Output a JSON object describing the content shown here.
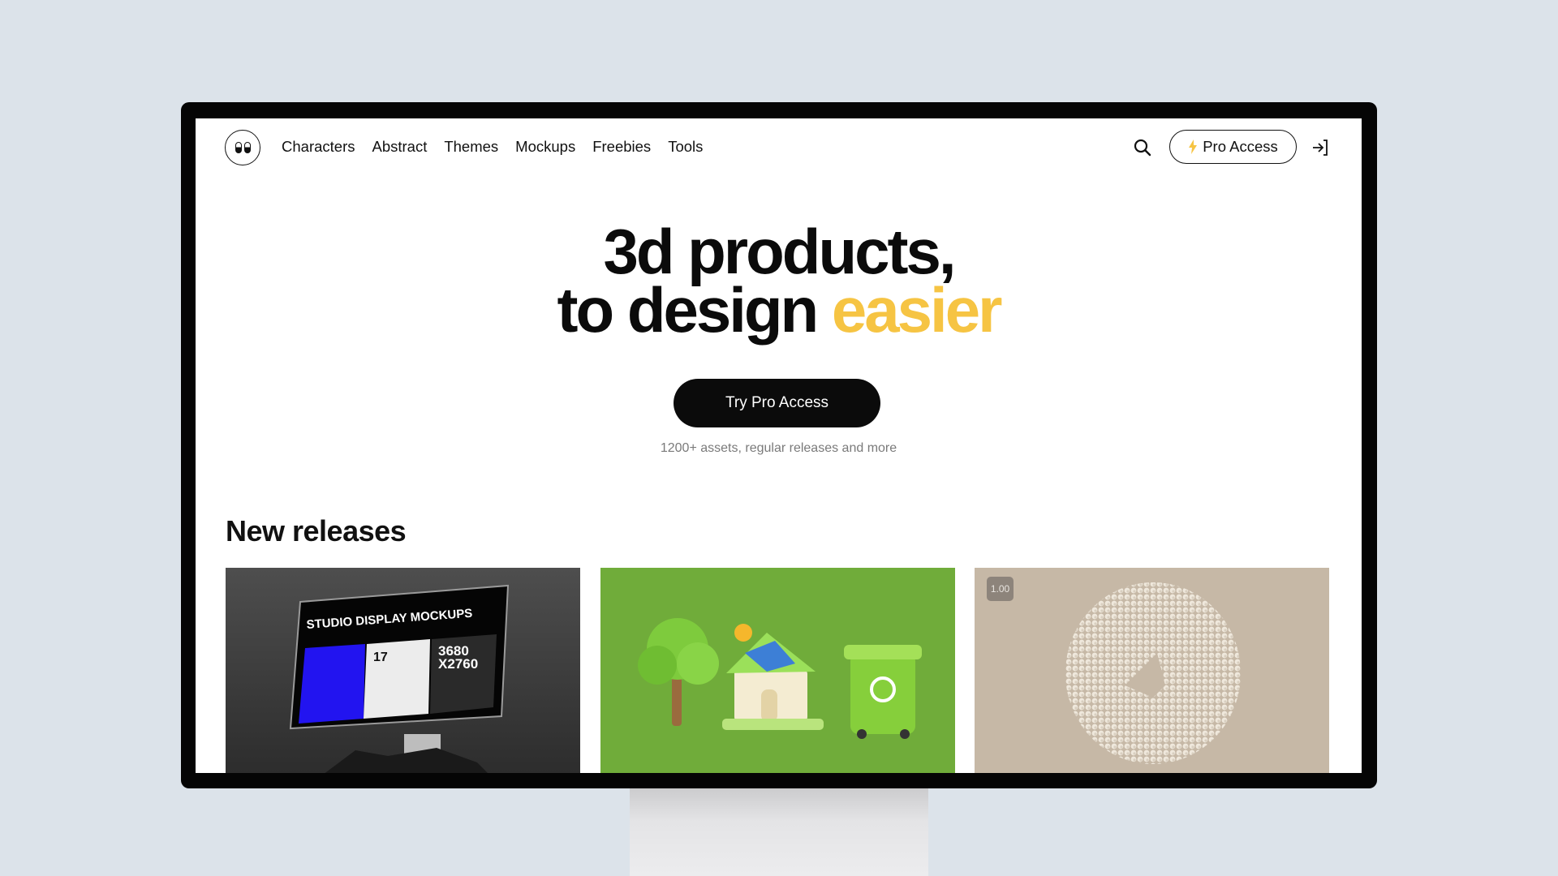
{
  "nav": {
    "logo_icon": "eyes-logo-icon",
    "links": [
      "Characters",
      "Abstract",
      "Themes",
      "Mockups",
      "Freebies",
      "Tools"
    ],
    "search_icon": "search-icon",
    "pro_button": "Pro Access",
    "pro_icon": "lightning-icon",
    "login_icon": "login-arrow-icon"
  },
  "hero": {
    "line1": "3d products,",
    "line2_prefix": "to design ",
    "line2_accent": "easier",
    "cta": "Try Pro Access",
    "subtext": "1200+ assets, regular releases and more"
  },
  "releases": {
    "title": "New releases",
    "cards": [
      {
        "name": "studio-display-mockups",
        "mock_title": "STUDIO DISPLAY MOCKUPS",
        "mock_num": "17",
        "mock_res1": "3680",
        "mock_res2": "X2760"
      },
      {
        "name": "eco-icons"
      },
      {
        "name": "abstract-sphere-torus",
        "badge": "1.00"
      }
    ]
  },
  "colors": {
    "accent": "#f6c443",
    "background": "#dce3ea",
    "primary": "#0b0b0b"
  }
}
